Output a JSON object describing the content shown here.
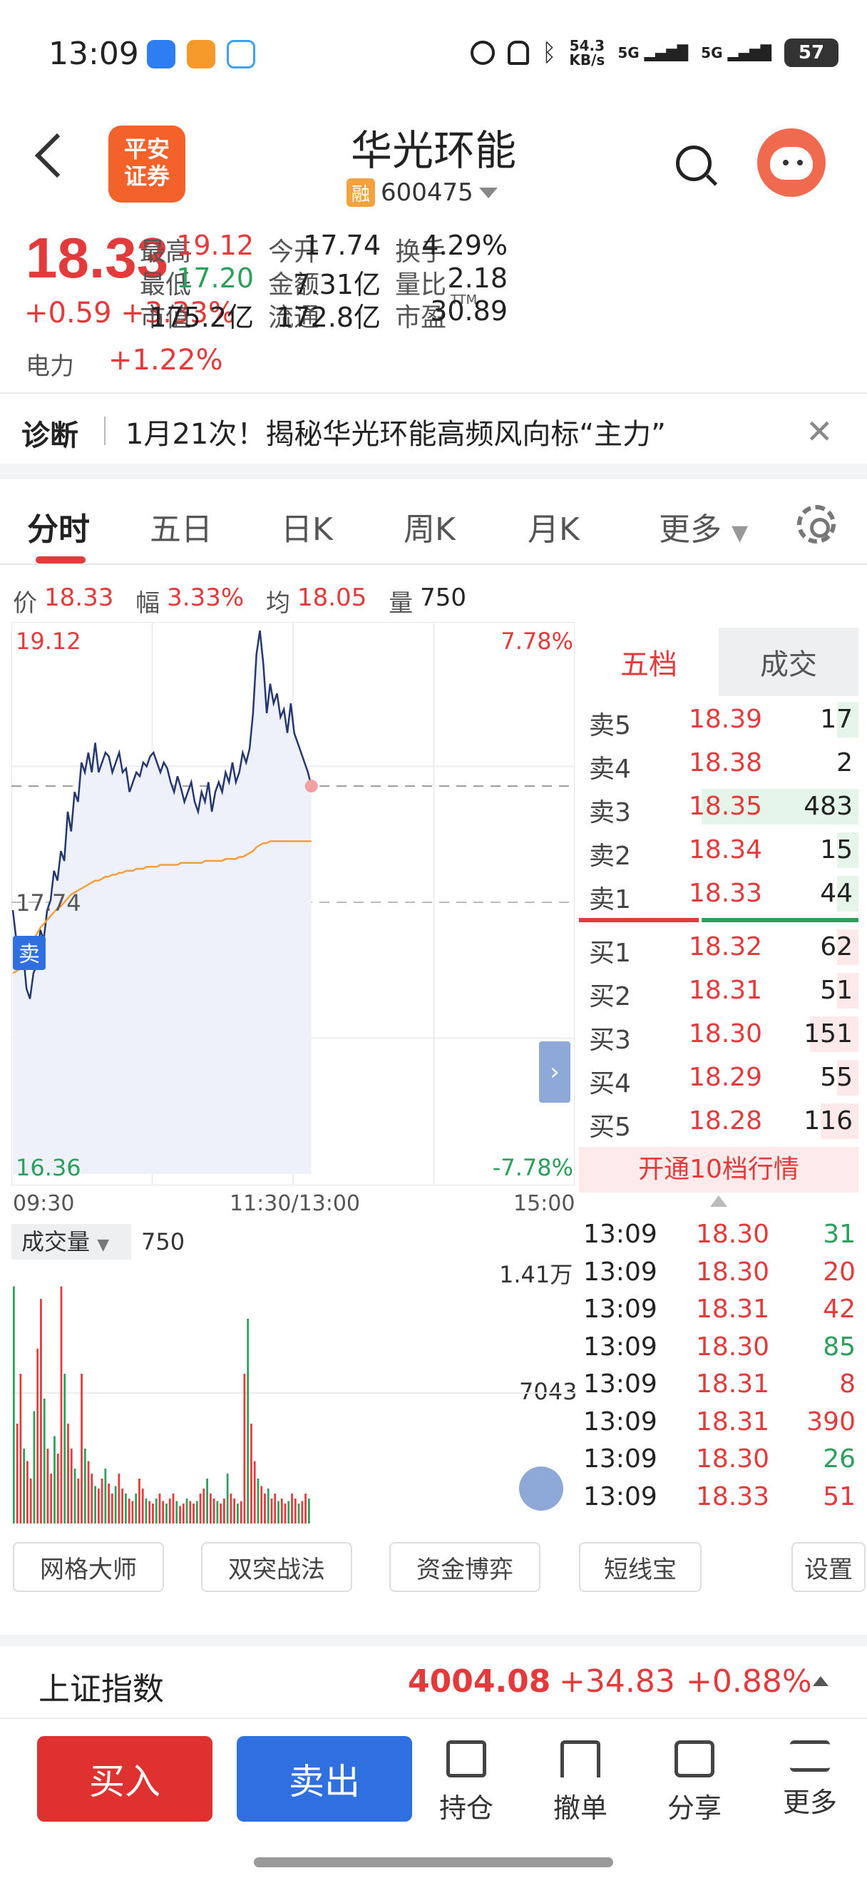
{
  "status_bar": {
    "time": "13:09",
    "net_speed_top": "54.3",
    "net_speed_unit": "KB/s",
    "signal1": "5G",
    "signal2": "5G",
    "battery": "57"
  },
  "header": {
    "logo_line1": "平安",
    "logo_line2": "证券",
    "stock_name": "华光环能",
    "rong_badge": "融",
    "stock_code": "600475"
  },
  "quote": {
    "price": "18.33",
    "change": "+0.59",
    "change_pct": "+3.33%",
    "sector_label": "电力",
    "sector_pct": "+1.22%",
    "fields": [
      {
        "label": "最高",
        "value": "19.12",
        "color": "red"
      },
      {
        "label": "今开",
        "value": "17.74",
        "color": "black"
      },
      {
        "label": "换手",
        "value": "4.29%",
        "color": "black"
      },
      {
        "label": "最低",
        "value": "17.20",
        "color": "green"
      },
      {
        "label": "金额",
        "value": "7.31亿",
        "color": "black"
      },
      {
        "label": "量比",
        "value": "2.18",
        "color": "black"
      },
      {
        "label": "市值",
        "value": "175.2亿",
        "color": "black"
      },
      {
        "label": "流通",
        "value": "172.8亿",
        "color": "black"
      },
      {
        "label": "市盈",
        "value": "30.89",
        "color": "black",
        "sup": "TTM"
      }
    ]
  },
  "diagnosis": {
    "label": "诊断",
    "text": "1月21次！揭秘华光环能高频风向标“主力”"
  },
  "tabs": {
    "items": [
      "分时",
      "五日",
      "日K",
      "周K",
      "月K",
      "更多"
    ],
    "active": 0
  },
  "chart_info": {
    "price_label": "价",
    "price": "18.33",
    "range_label": "幅",
    "range": "3.33%",
    "avg_label": "均",
    "avg": "18.05",
    "vol_label": "量",
    "vol": "750"
  },
  "chart_data": {
    "type": "line",
    "y_max_label": "19.12",
    "y_max_pct": "7.78%",
    "y_min_label": "16.36",
    "y_min_pct": "-7.78%",
    "prev_close_label": "17.74",
    "sell_marker": "卖",
    "x_labels": [
      "09:30",
      "11:30/13:00",
      "15:00"
    ],
    "ylim": [
      16.36,
      19.12
    ],
    "prev_close": 17.74,
    "current": 18.33,
    "series": [
      {
        "values": [
          17.7,
          17.55,
          17.4,
          17.48,
          17.3,
          17.25,
          17.38,
          17.42,
          17.6,
          17.55,
          17.7,
          17.75,
          17.9,
          17.85,
          18.0,
          17.95,
          18.2,
          18.1,
          18.3,
          18.25,
          18.45,
          18.4,
          18.5,
          18.4,
          18.55,
          18.4,
          18.45,
          18.5,
          18.48,
          18.4,
          18.45,
          18.5,
          18.4,
          18.42,
          18.3,
          18.35,
          18.4,
          18.38,
          18.45,
          18.43,
          18.48,
          18.5,
          18.45,
          18.4,
          18.45,
          18.42,
          18.35,
          18.3,
          18.38,
          18.32,
          18.25,
          18.3,
          18.35,
          18.25,
          18.2,
          18.3,
          18.25,
          18.35,
          18.2,
          18.3,
          18.35,
          18.3,
          18.4,
          18.35,
          18.45,
          18.35,
          18.4,
          18.5,
          18.45,
          18.52,
          18.7,
          19.0,
          19.12,
          18.95,
          18.7,
          18.85,
          18.75,
          18.8,
          18.68,
          18.72,
          18.6,
          18.75,
          18.6,
          18.55,
          18.5,
          18.45,
          18.4,
          18.33
        ]
      },
      {
        "values": [
          17.38,
          17.39,
          17.4,
          17.42,
          17.45,
          17.5,
          17.55,
          17.58,
          17.61,
          17.63,
          17.65,
          17.67,
          17.69,
          17.71,
          17.72,
          17.74,
          17.76,
          17.78,
          17.79,
          17.8,
          17.81,
          17.82,
          17.83,
          17.84,
          17.85,
          17.85,
          17.86,
          17.87,
          17.87,
          17.88,
          17.88,
          17.89,
          17.89,
          17.9,
          17.9,
          17.9,
          17.91,
          17.91,
          17.91,
          17.92,
          17.92,
          17.92,
          17.92,
          17.93,
          17.93,
          17.93,
          17.93,
          17.93,
          17.93,
          17.94,
          17.94,
          17.94,
          17.94,
          17.94,
          17.94,
          17.94,
          17.95,
          17.95,
          17.95,
          17.95,
          17.95,
          17.95,
          17.96,
          17.96,
          17.96,
          17.96,
          17.97,
          17.97,
          17.98,
          17.99,
          18.0,
          18.02,
          18.03,
          18.04,
          18.04,
          18.05,
          18.05,
          18.05,
          18.05,
          18.05,
          18.05,
          18.05,
          18.05,
          18.05,
          18.05,
          18.05,
          18.05,
          18.05
        ]
      }
    ]
  },
  "volume": {
    "label": "成交量",
    "value": "750",
    "max_label": "1.41万",
    "mid_label": "7043",
    "bars": [
      95,
      40,
      60,
      30,
      25,
      18,
      45,
      70,
      90,
      50,
      30,
      20,
      35,
      28,
      95,
      60,
      40,
      30,
      22,
      18,
      60,
      30,
      25,
      20,
      15,
      14,
      18,
      22,
      16,
      12,
      15,
      20,
      14,
      12,
      10,
      9,
      12,
      18,
      14,
      10,
      9,
      8,
      10,
      12,
      9,
      8,
      10,
      12,
      9,
      7,
      8,
      10,
      9,
      8,
      9,
      12,
      14,
      18,
      12,
      10,
      9,
      8,
      10,
      20,
      12,
      10,
      8,
      9,
      60,
      82,
      40,
      25,
      18,
      15,
      12,
      14,
      10,
      12,
      9,
      10,
      8,
      9,
      12,
      10,
      8,
      9,
      12,
      10
    ]
  },
  "order_book": {
    "tab_active": "五档",
    "tab_inactive": "成交",
    "asks": [
      {
        "label": "卖5",
        "price": "18.39",
        "vol": "17",
        "frac": 0.04
      },
      {
        "label": "卖4",
        "price": "18.38",
        "vol": "2",
        "frac": 0.0
      },
      {
        "label": "卖3",
        "price": "18.35",
        "vol": "483",
        "frac": 1.0
      },
      {
        "label": "卖2",
        "price": "18.34",
        "vol": "15",
        "frac": 0.03
      },
      {
        "label": "卖1",
        "price": "18.33",
        "vol": "44",
        "frac": 0.09
      }
    ],
    "bids": [
      {
        "label": "买1",
        "price": "18.32",
        "vol": "62",
        "frac": 0.13
      },
      {
        "label": "买2",
        "price": "18.31",
        "vol": "51",
        "frac": 0.11
      },
      {
        "label": "买3",
        "price": "18.30",
        "vol": "151",
        "frac": 0.31
      },
      {
        "label": "买4",
        "price": "18.29",
        "vol": "55",
        "frac": 0.11
      },
      {
        "label": "买5",
        "price": "18.28",
        "vol": "116",
        "frac": 0.24
      }
    ],
    "open10": "开通10档行情"
  },
  "trades": [
    {
      "time": "13:09",
      "price": "18.30",
      "vol": "31",
      "side": "green"
    },
    {
      "time": "13:09",
      "price": "18.30",
      "vol": "20",
      "side": "red"
    },
    {
      "time": "13:09",
      "price": "18.31",
      "vol": "42",
      "side": "red"
    },
    {
      "time": "13:09",
      "price": "18.30",
      "vol": "85",
      "side": "green"
    },
    {
      "time": "13:09",
      "price": "18.31",
      "vol": "8",
      "side": "red"
    },
    {
      "time": "13:09",
      "price": "18.31",
      "vol": "390",
      "side": "red"
    },
    {
      "time": "13:09",
      "price": "18.30",
      "vol": "26",
      "side": "green"
    },
    {
      "time": "13:09",
      "price": "18.33",
      "vol": "51",
      "side": "red"
    }
  ],
  "tools": [
    "网格大师",
    "双突战法",
    "资金博弈",
    "短线宝",
    "设置"
  ],
  "index": {
    "name": "上证指数",
    "value": "4004.08",
    "change": "+34.83",
    "pct": "+0.88%"
  },
  "actions": {
    "buy": "买入",
    "sell": "卖出",
    "items": [
      "持仓",
      "撤单",
      "分享",
      "更多"
    ]
  },
  "colors": {
    "red": "#e33b3b",
    "green": "#2aa05a",
    "blue": "#2f6fe0",
    "price_line": "#24376e",
    "avg_line": "#f0a040"
  }
}
